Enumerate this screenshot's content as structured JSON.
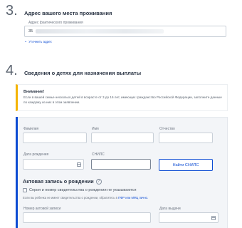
{
  "section3": {
    "num": "3.",
    "title": "Адрес вашего места проживания"
  },
  "address": {
    "label": "Адрес фактического проживания",
    "value_prefix": "35",
    "link": "Уточнить адрес"
  },
  "section4": {
    "num": "4.",
    "title": "Сведения о детях для назначения выплаты"
  },
  "warning": {
    "title": "Внимание!",
    "text": "Если в вашей семье несколько детей в возрасте от 3 до 16 лет, имеющих гражданство Российской Федерации, заполните данные по каждому из них в этом заявлении."
  },
  "form": {
    "surname_label": "Фамилия",
    "name_label": "Имя",
    "patronymic_label": "Отчество",
    "birthdate_label": "Дата рождения",
    "snils_label": "СНИЛС",
    "find_snils_button": "Найти СНИЛС",
    "birth_record_title": "Актовая запись о рождении",
    "no_certificate_checkbox": "Серия и номер свидетельства о рождении не указываются",
    "hint_text": "Если вы ребенка не имеет свидетельства о рождении, обратитесь в ",
    "hint_link": "ПФР или МФЦ лично.",
    "record_number_label": "Номер актовой записи",
    "issue_date_label": "Дата выдачи"
  },
  "colors": {
    "accent": "#0d4cd3",
    "warning": "#f4b400",
    "panel_bg": "#f3f5f8"
  }
}
